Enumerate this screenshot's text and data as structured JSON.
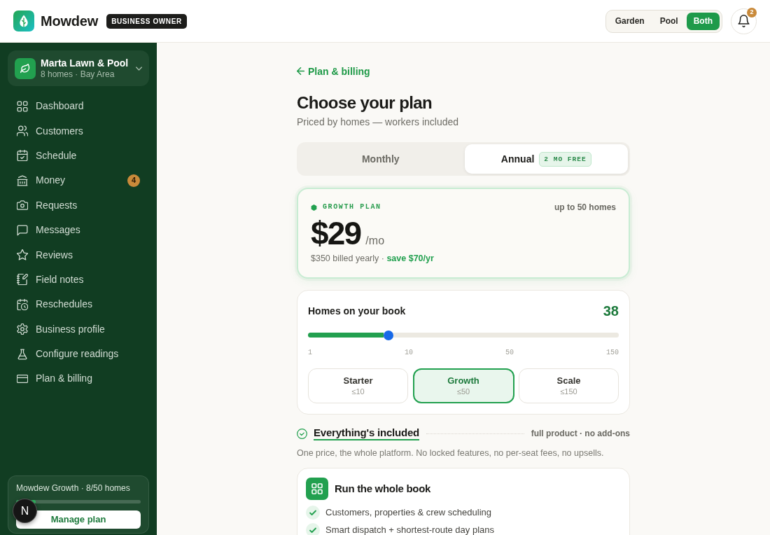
{
  "topbar": {
    "brand": "Mowdew",
    "role_badge": "BUSINESS OWNER",
    "service_filter": [
      {
        "label": "Garden",
        "selected": false
      },
      {
        "label": "Pool",
        "selected": false
      },
      {
        "label": "Both",
        "selected": true
      }
    ],
    "notifications": {
      "count": "2"
    }
  },
  "sidebar": {
    "business": {
      "name": "Marta Lawn & Pool",
      "subtitle": "8 homes · Bay Area"
    },
    "items": [
      {
        "label": "Dashboard",
        "selected": false
      },
      {
        "label": "Customers",
        "selected": false
      },
      {
        "label": "Schedule",
        "selected": false
      },
      {
        "label": "Money",
        "selected": false,
        "badge": "4"
      },
      {
        "label": "Requests",
        "selected": false
      },
      {
        "label": "Messages",
        "selected": false
      },
      {
        "label": "Reviews",
        "selected": false
      },
      {
        "label": "Field notes",
        "selected": false
      },
      {
        "label": "Reschedules",
        "selected": false
      },
      {
        "label": "Business profile",
        "selected": false
      },
      {
        "label": "Configure readings",
        "selected": false
      },
      {
        "label": "Plan & billing",
        "selected": false
      }
    ],
    "plan_card": {
      "title": "Mowdew Growth · 8/50 homes",
      "level": 0.16,
      "button": "Manage plan"
    }
  },
  "dev_indicator": {
    "label": "N"
  },
  "main": {
    "back_link": "Plan & billing",
    "title": "Choose your plan",
    "subtitle": "Priced by homes — workers included",
    "billing_toggle": [
      {
        "label": "Monthly",
        "selected": false
      },
      {
        "label": "Annual",
        "selected": true,
        "badge": "2 MO FREE"
      }
    ],
    "plan_summary": {
      "plan_label": "GROWTH PLAN",
      "limit": "up to 50 homes",
      "price": "$29",
      "period": "/mo",
      "billing_note": "$350 billed yearly · **save $70/yr**"
    },
    "homes": {
      "label": "Homes on your book",
      "value": "38",
      "level": 0.26,
      "ticks": [
        "1",
        "10",
        "50",
        "150"
      ],
      "tiers": [
        {
          "name": "Starter",
          "limit": "≤10",
          "selected": false
        },
        {
          "name": "Growth",
          "limit": "≤50",
          "selected": true
        },
        {
          "name": "Scale",
          "limit": "≤150",
          "selected": false
        }
      ]
    },
    "included": {
      "title": "Everything's included",
      "note": "full product · no add-ons",
      "description": "One price, the whole platform. No locked features, no per-seat fees, no upsells."
    },
    "feature_groups": [
      {
        "title": "Run the whole book",
        "items": [
          "Customers, properties & crew scheduling",
          "Smart dispatch + shortest-route day plans"
        ]
      }
    ]
  }
}
